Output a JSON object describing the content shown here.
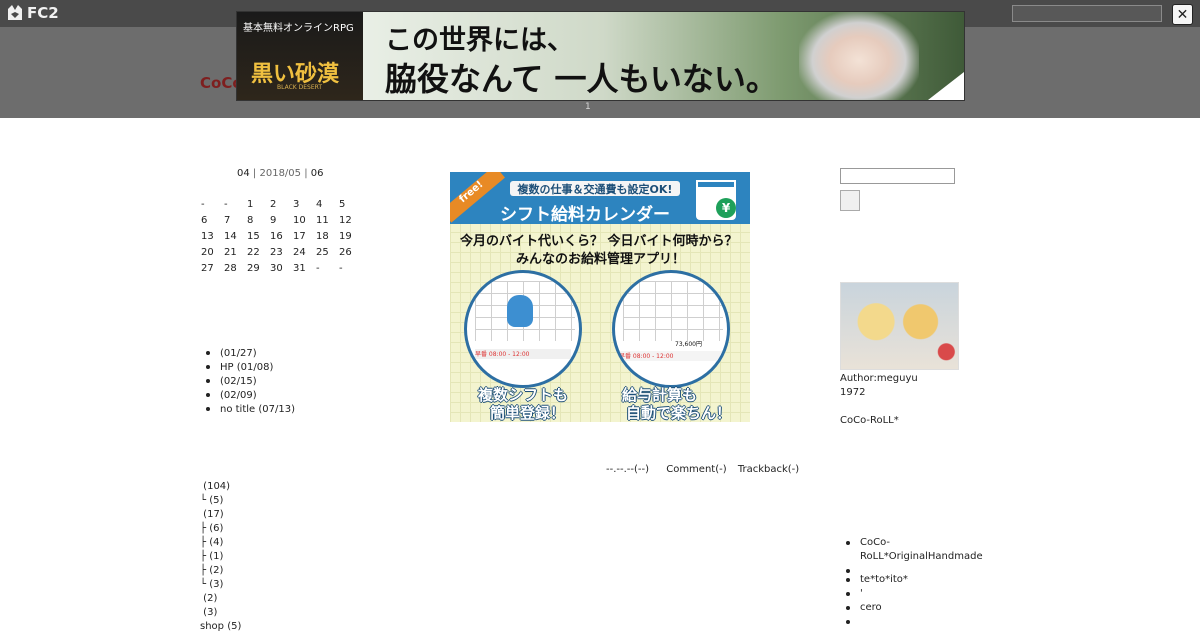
{
  "topbar": {
    "logo_text": "FC2",
    "close_glyph": "✕"
  },
  "blog": {
    "title_visible": "CoCo"
  },
  "ad_banner": {
    "left_top": "基本無料オンラインRPG",
    "left_title": "黒い砂漠",
    "left_sub": "BLACK DESERT",
    "copy_line1": "この世界には、",
    "copy_line2": "脇役なんて 一人もいない。",
    "counter": "1"
  },
  "calendar": {
    "prev": "04",
    "current": "2018/05",
    "next": "06",
    "weeks": [
      [
        "-",
        "-",
        "1",
        "2",
        "3",
        "4",
        "5"
      ],
      [
        "6",
        "7",
        "8",
        "9",
        "10",
        "11",
        "12"
      ],
      [
        "13",
        "14",
        "15",
        "16",
        "17",
        "18",
        "19"
      ],
      [
        "20",
        "21",
        "22",
        "23",
        "24",
        "25",
        "26"
      ],
      [
        "27",
        "28",
        "29",
        "30",
        "31",
        "-",
        "-"
      ]
    ]
  },
  "recent_entries": [
    " (01/27)",
    "HP (01/08)",
    " (02/15)",
    " (02/09)",
    "no title (07/13)"
  ],
  "categories": [
    " (104)",
    "└ (5)",
    " (17)",
    "├ (6)",
    "├ (4)",
    "├ (1)",
    "├ (2)",
    "└ (3)",
    " (2)",
    " (3)",
    "shop (5)"
  ],
  "mid_ad": {
    "free_tag": "free!",
    "subtitle": "複数の仕事＆交通費も設定OK!",
    "title": "シフト給料カレンダー",
    "yen": "¥",
    "question1": "今月のバイト代いくら？ 今日バイト何時から？",
    "question2": "みんなのお給料管理アプリ！",
    "circle1_bar": "早番 08:00 - 12:00",
    "circle2_bar": "早番 08:00 - 12:00",
    "circle2_amount": "73,600円",
    "foot_left_1": "複数シフトも",
    "foot_left_2": "簡単登録！",
    "foot_right_1": "給与計算も",
    "foot_right_2": "自動で楽ちん！"
  },
  "post_meta": {
    "date": "--.--.--(--)",
    "comment": "Comment(-)",
    "trackback": "Trackback(-)"
  },
  "sidebar": {
    "author": "Author:meguyu",
    "year": "1972",
    "blog_name": "CoCo-RoLL*"
  },
  "links": [
    "CoCo-RoLL*OriginalHandmade",
    "",
    "te*to*ito*",
    "'",
    "cero",
    ""
  ]
}
